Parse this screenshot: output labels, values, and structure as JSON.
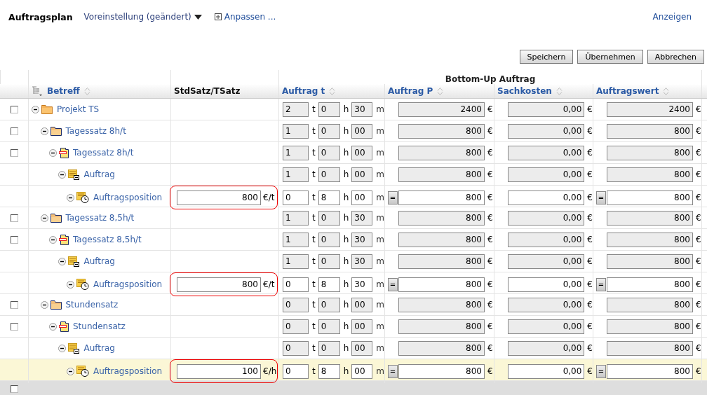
{
  "header": {
    "title": "Auftragsplan",
    "preset": "Voreinstellung (geändert)",
    "customize": "Anpassen ...",
    "show": "Anzeigen"
  },
  "buttons": [
    "Speichern",
    "Übernehmen",
    "Abbrechen"
  ],
  "table": {
    "group_heading": "Bottom-Up Auftrag",
    "columns": [
      {
        "label": "Betreff",
        "kind": "tree",
        "sortable": true
      },
      {
        "label": "StdSatz/TSatz",
        "kind": "plain",
        "sortable": false
      },
      {
        "label": "Auftrag t",
        "kind": "plain",
        "sortable": true
      },
      {
        "label": "Auftrag P",
        "kind": "plain",
        "sortable": true
      },
      {
        "label": "Sachkosten",
        "kind": "plain",
        "sortable": true
      },
      {
        "label": "Auftragswert",
        "kind": "plain",
        "sortable": true
      }
    ],
    "rows": [
      {
        "label": "Projekt TS",
        "kind": "project",
        "expanded": true,
        "selected": false,
        "checkbox": {
          "checked": false
        },
        "editable": false,
        "time": [
          {
            "value": "2",
            "unit": "t"
          },
          {
            "value": "0",
            "unit": "h"
          },
          {
            "value": "30",
            "unit": "m"
          }
        ],
        "amounts": [
          {
            "value": "2400",
            "unit": "€"
          },
          {
            "value": "0,00",
            "unit": "€"
          },
          {
            "value": "2400",
            "unit": "€"
          }
        ],
        "children": [
          {
            "label": "Tagessatz 8h/t",
            "kind": "group",
            "expanded": true,
            "selected": false,
            "checkbox": {
              "checked": false
            },
            "editable": false,
            "time": [
              {
                "value": "1",
                "unit": "t"
              },
              {
                "value": "0",
                "unit": "h"
              },
              {
                "value": "00",
                "unit": "m"
              }
            ],
            "amounts": [
              {
                "value": "800",
                "unit": "€"
              },
              {
                "value": "0,00",
                "unit": "€"
              },
              {
                "value": "800",
                "unit": "€"
              }
            ],
            "children": [
              {
                "label": "Tagessatz 8h/t",
                "kind": "subgroup",
                "expanded": true,
                "selected": false,
                "checkbox": {
                  "checked": false
                },
                "editable": false,
                "time": [
                  {
                    "value": "1",
                    "unit": "t"
                  },
                  {
                    "value": "0",
                    "unit": "h"
                  },
                  {
                    "value": "00",
                    "unit": "m"
                  }
                ],
                "amounts": [
                  {
                    "value": "800",
                    "unit": "€"
                  },
                  {
                    "value": "0,00",
                    "unit": "€"
                  },
                  {
                    "value": "800",
                    "unit": "€"
                  }
                ],
                "children": [
                  {
                    "label": "Auftrag",
                    "kind": "order",
                    "expanded": true,
                    "selected": false,
                    "editable": false,
                    "time": [
                      {
                        "value": "1",
                        "unit": "t"
                      },
                      {
                        "value": "0",
                        "unit": "h"
                      },
                      {
                        "value": "00",
                        "unit": "m"
                      }
                    ],
                    "amounts": [
                      {
                        "value": "800",
                        "unit": "€"
                      },
                      {
                        "value": "0,00",
                        "unit": "€"
                      },
                      {
                        "value": "800",
                        "unit": "€"
                      }
                    ],
                    "children": [
                      {
                        "label": "Auftragsposition",
                        "kind": "position",
                        "expanded": true,
                        "selected": false,
                        "editable": true,
                        "rate": {
                          "value": "800",
                          "unit": "€/t",
                          "marked": true
                        },
                        "time": [
                          {
                            "value": "0",
                            "unit": "t"
                          },
                          {
                            "value": "8",
                            "unit": "h"
                          },
                          {
                            "value": "00",
                            "unit": "m"
                          }
                        ],
                        "amounts": [
                          {
                            "button": "=",
                            "value": "800",
                            "unit": "€"
                          },
                          {
                            "value": "0,00",
                            "unit": "€"
                          },
                          {
                            "button": "=",
                            "value": "800",
                            "unit": "€"
                          }
                        ]
                      }
                    ]
                  }
                ]
              }
            ]
          },
          {
            "label": "Tagessatz 8,5h/t",
            "kind": "group",
            "expanded": true,
            "selected": false,
            "checkbox": {
              "checked": false
            },
            "editable": false,
            "time": [
              {
                "value": "1",
                "unit": "t"
              },
              {
                "value": "0",
                "unit": "h"
              },
              {
                "value": "30",
                "unit": "m"
              }
            ],
            "amounts": [
              {
                "value": "800",
                "unit": "€"
              },
              {
                "value": "0,00",
                "unit": "€"
              },
              {
                "value": "800",
                "unit": "€"
              }
            ],
            "children": [
              {
                "label": "Tagessatz 8,5h/t",
                "kind": "subgroup",
                "expanded": true,
                "selected": false,
                "checkbox": {
                  "checked": false
                },
                "editable": false,
                "time": [
                  {
                    "value": "1",
                    "unit": "t"
                  },
                  {
                    "value": "0",
                    "unit": "h"
                  },
                  {
                    "value": "30",
                    "unit": "m"
                  }
                ],
                "amounts": [
                  {
                    "value": "800",
                    "unit": "€"
                  },
                  {
                    "value": "0,00",
                    "unit": "€"
                  },
                  {
                    "value": "800",
                    "unit": "€"
                  }
                ],
                "children": [
                  {
                    "label": "Auftrag",
                    "kind": "order",
                    "expanded": true,
                    "selected": false,
                    "editable": false,
                    "time": [
                      {
                        "value": "1",
                        "unit": "t"
                      },
                      {
                        "value": "0",
                        "unit": "h"
                      },
                      {
                        "value": "30",
                        "unit": "m"
                      }
                    ],
                    "amounts": [
                      {
                        "value": "800",
                        "unit": "€"
                      },
                      {
                        "value": "0,00",
                        "unit": "€"
                      },
                      {
                        "value": "800",
                        "unit": "€"
                      }
                    ],
                    "children": [
                      {
                        "label": "Auftragsposition",
                        "kind": "position",
                        "expanded": true,
                        "selected": false,
                        "editable": true,
                        "rate": {
                          "value": "800",
                          "unit": "€/t",
                          "marked": true
                        },
                        "time": [
                          {
                            "value": "0",
                            "unit": "t"
                          },
                          {
                            "value": "8",
                            "unit": "h"
                          },
                          {
                            "value": "30",
                            "unit": "m"
                          }
                        ],
                        "amounts": [
                          {
                            "button": "=",
                            "value": "800",
                            "unit": "€"
                          },
                          {
                            "value": "0,00",
                            "unit": "€"
                          },
                          {
                            "button": "=",
                            "value": "800",
                            "unit": "€"
                          }
                        ]
                      }
                    ]
                  }
                ]
              }
            ]
          },
          {
            "label": "Stundensatz",
            "kind": "group",
            "expanded": true,
            "selected": false,
            "checkbox": {
              "checked": false
            },
            "editable": false,
            "time": [
              {
                "value": "0",
                "unit": "t"
              },
              {
                "value": "0",
                "unit": "h"
              },
              {
                "value": "00",
                "unit": "m"
              }
            ],
            "amounts": [
              {
                "value": "800",
                "unit": "€"
              },
              {
                "value": "0,00",
                "unit": "€"
              },
              {
                "value": "800",
                "unit": "€"
              }
            ],
            "children": [
              {
                "label": "Stundensatz",
                "kind": "subgroup",
                "expanded": true,
                "selected": false,
                "checkbox": {
                  "checked": false
                },
                "editable": false,
                "time": [
                  {
                    "value": "0",
                    "unit": "t"
                  },
                  {
                    "value": "0",
                    "unit": "h"
                  },
                  {
                    "value": "00",
                    "unit": "m"
                  }
                ],
                "amounts": [
                  {
                    "value": "800",
                    "unit": "€"
                  },
                  {
                    "value": "0,00",
                    "unit": "€"
                  },
                  {
                    "value": "800",
                    "unit": "€"
                  }
                ],
                "children": [
                  {
                    "label": "Auftrag",
                    "kind": "order",
                    "expanded": true,
                    "selected": false,
                    "editable": false,
                    "time": [
                      {
                        "value": "0",
                        "unit": "t"
                      },
                      {
                        "value": "0",
                        "unit": "h"
                      },
                      {
                        "value": "00",
                        "unit": "m"
                      }
                    ],
                    "amounts": [
                      {
                        "value": "800",
                        "unit": "€"
                      },
                      {
                        "value": "0,00",
                        "unit": "€"
                      },
                      {
                        "value": "800",
                        "unit": "€"
                      }
                    ],
                    "children": [
                      {
                        "label": "Auftragsposition",
                        "kind": "position",
                        "expanded": true,
                        "selected": true,
                        "editable": true,
                        "rate": {
                          "value": "100",
                          "unit": "€/h",
                          "marked": true
                        },
                        "time": [
                          {
                            "value": "0",
                            "unit": "t"
                          },
                          {
                            "value": "8",
                            "unit": "h"
                          },
                          {
                            "value": "00",
                            "unit": "m"
                          }
                        ],
                        "amounts": [
                          {
                            "button": "=",
                            "value": "800",
                            "unit": "€"
                          },
                          {
                            "value": "0,00",
                            "unit": "€"
                          },
                          {
                            "button": "=",
                            "value": "800",
                            "unit": "€"
                          }
                        ]
                      }
                    ]
                  }
                ]
              }
            ]
          }
        ]
      }
    ],
    "footer": {
      "checkbox": {
        "checked": false
      }
    }
  }
}
